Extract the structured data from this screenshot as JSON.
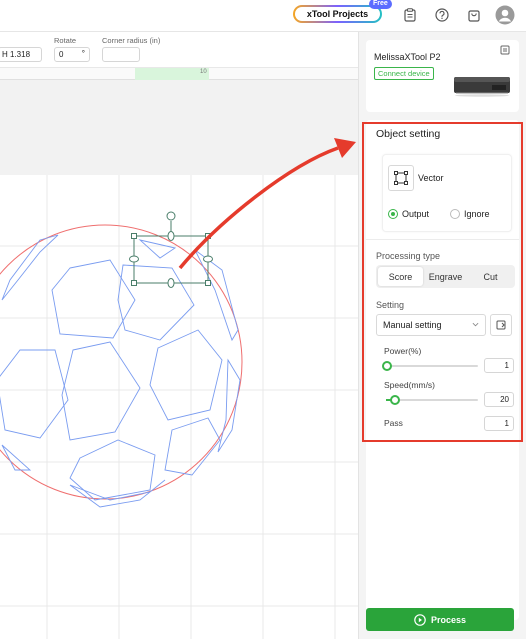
{
  "topbar": {
    "xtool_projects_label": "xTool Projects",
    "free_badge": "Free",
    "icons": [
      "clipboard-icon",
      "help-icon",
      "shopping-bag-icon",
      "avatar-icon"
    ]
  },
  "propbar": {
    "height_value": "H 1.318",
    "rotate_label": "Rotate",
    "rotate_value": "0",
    "rotate_unit": "°",
    "corner_radius_label": "Corner radius (in)",
    "corner_radius_value": ""
  },
  "ruler": {
    "mark": "10"
  },
  "device": {
    "name": "MelissaXTool P2",
    "connect_label": "Connect device"
  },
  "object_setting": {
    "title": "Object setting",
    "type_label": "Vector",
    "output_label": "Output",
    "ignore_label": "Ignore",
    "output_selected": true,
    "processing_type_label": "Processing type",
    "processing_tabs": [
      "Score",
      "Engrave",
      "Cut"
    ],
    "active_processing_tab": "Score",
    "setting_label": "Setting",
    "setting_value": "Manual setting",
    "power_label": "Power(%)",
    "power_value": "1",
    "power_fraction": 0.01,
    "speed_label": "Speed(mm/s)",
    "speed_value": "20",
    "speed_fraction": 0.1,
    "pass_label": "Pass",
    "pass_value": "1"
  },
  "process_button_label": "Process",
  "colors": {
    "accent_green": "#3ab54a",
    "process_green": "#2aa43a",
    "annotation_red": "#e53b2c",
    "vector_blue": "#7a9cf0"
  }
}
